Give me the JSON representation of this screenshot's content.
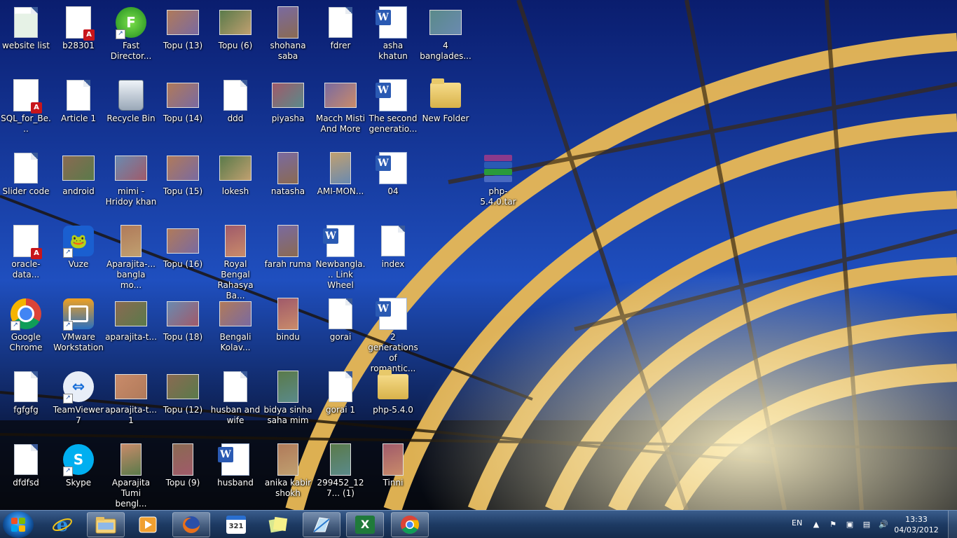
{
  "desktop": {
    "icons": [
      {
        "id": "website-list",
        "label": "website list",
        "kind": "excel-doc"
      },
      {
        "id": "b28301",
        "label": "b28301",
        "kind": "pdf"
      },
      {
        "id": "fast-director",
        "label": "Fast Director...",
        "kind": "app-green"
      },
      {
        "id": "topu-13",
        "label": "Topu (13)",
        "kind": "photo"
      },
      {
        "id": "topu-6",
        "label": "Topu (6)",
        "kind": "photo"
      },
      {
        "id": "shohana-saba",
        "label": "shohana saba",
        "kind": "photo-tall"
      },
      {
        "id": "fdrer",
        "label": "fdrer",
        "kind": "doc"
      },
      {
        "id": "asha-khatun",
        "label": "asha khatun",
        "kind": "word"
      },
      {
        "id": "4-banglades",
        "label": "4 banglades...",
        "kind": "photo"
      },
      {
        "id": "sql-for-be",
        "label": "SQL_for_Be...",
        "kind": "pdf"
      },
      {
        "id": "article-1",
        "label": "Article 1",
        "kind": "doc"
      },
      {
        "id": "recycle-bin",
        "label": "Recycle Bin",
        "kind": "bin"
      },
      {
        "id": "topu-14",
        "label": "Topu (14)",
        "kind": "photo"
      },
      {
        "id": "ddd",
        "label": "ddd",
        "kind": "doc"
      },
      {
        "id": "piyasha",
        "label": "piyasha",
        "kind": "photo"
      },
      {
        "id": "macch-misti",
        "label": "Macch Misti And More",
        "kind": "photo"
      },
      {
        "id": "the-second",
        "label": "The second generatio...",
        "kind": "word"
      },
      {
        "id": "new-folder",
        "label": "New Folder",
        "kind": "folder"
      },
      {
        "id": "slider-code",
        "label": "Slider code",
        "kind": "doc"
      },
      {
        "id": "android",
        "label": "android",
        "kind": "photo"
      },
      {
        "id": "mimi",
        "label": "mimi - Hridoy khan",
        "kind": "photo"
      },
      {
        "id": "topu-15",
        "label": "Topu (15)",
        "kind": "photo"
      },
      {
        "id": "lokesh",
        "label": "lokesh",
        "kind": "photo"
      },
      {
        "id": "natasha",
        "label": "natasha",
        "kind": "photo-tall"
      },
      {
        "id": "ami-mon",
        "label": "AMI-MON...",
        "kind": "photo-tall"
      },
      {
        "id": "04",
        "label": "04",
        "kind": "word"
      },
      {
        "id": "php-tar",
        "label": "php-5.4.0.tar",
        "kind": "rar"
      },
      {
        "id": "oracle-data",
        "label": "oracle-data...",
        "kind": "pdf"
      },
      {
        "id": "vuze",
        "label": "Vuze",
        "kind": "app-vuze"
      },
      {
        "id": "aparajita-bangla",
        "label": "Aparajita-... bangla mo...",
        "kind": "photo-tall"
      },
      {
        "id": "topu-16",
        "label": "Topu (16)",
        "kind": "photo"
      },
      {
        "id": "royal-bengal",
        "label": "Royal Bengal Rahasya Ba...",
        "kind": "photo-tall"
      },
      {
        "id": "farah-ruma",
        "label": "farah ruma",
        "kind": "photo-tall"
      },
      {
        "id": "newbangla",
        "label": "Newbangla... Link Wheel",
        "kind": "word"
      },
      {
        "id": "index",
        "label": "index",
        "kind": "doc"
      },
      {
        "id": "google-chrome",
        "label": "Google Chrome",
        "kind": "app-chrome"
      },
      {
        "id": "vmware",
        "label": "VMware Workstation",
        "kind": "app-vmware"
      },
      {
        "id": "aparajita-t1",
        "label": "aparajita-t...",
        "kind": "photo"
      },
      {
        "id": "topu-18",
        "label": "Topu (18)",
        "kind": "photo"
      },
      {
        "id": "bengali-kolav",
        "label": "Bengali Kolav...",
        "kind": "photo"
      },
      {
        "id": "bindu",
        "label": "bindu",
        "kind": "photo-tall"
      },
      {
        "id": "gorai",
        "label": "gorai",
        "kind": "doc"
      },
      {
        "id": "2-generations",
        "label": "2 generations of romantic...",
        "kind": "word"
      },
      {
        "id": "fgfgfg",
        "label": "fgfgfg",
        "kind": "doc"
      },
      {
        "id": "teamviewer",
        "label": "TeamViewer 7",
        "kind": "app-teamviewer"
      },
      {
        "id": "aparajita-t2",
        "label": "aparajita-t... 1",
        "kind": "photo"
      },
      {
        "id": "topu-12",
        "label": "Topu (12)",
        "kind": "photo"
      },
      {
        "id": "husban-and-wife",
        "label": "husban and wife",
        "kind": "doc"
      },
      {
        "id": "bidya-sinha",
        "label": "bidya sinha saha mim",
        "kind": "photo-tall"
      },
      {
        "id": "gorai-1",
        "label": "gorai 1",
        "kind": "doc"
      },
      {
        "id": "php-540",
        "label": "php-5.4.0",
        "kind": "folder"
      },
      {
        "id": "dfdfsd",
        "label": "dfdfsd",
        "kind": "doc"
      },
      {
        "id": "skype",
        "label": "Skype",
        "kind": "app-skype"
      },
      {
        "id": "aparajita-tumi",
        "label": "Aparajita Tumi bengl...",
        "kind": "photo-tall"
      },
      {
        "id": "topu-9",
        "label": "Topu (9)",
        "kind": "photo-tall"
      },
      {
        "id": "husband",
        "label": "husband",
        "kind": "word"
      },
      {
        "id": "anika-kabir",
        "label": "anika kabir shokh",
        "kind": "photo-tall"
      },
      {
        "id": "299452",
        "label": "299452_127... (1)",
        "kind": "photo-tall"
      },
      {
        "id": "tinni",
        "label": "Tinni",
        "kind": "photo-tall"
      }
    ]
  },
  "taskbar": {
    "pinned": [
      {
        "id": "ie",
        "icon": "internet-explorer-icon"
      },
      {
        "id": "explorer",
        "icon": "windows-explorer-icon"
      },
      {
        "id": "media",
        "icon": "media-player-icon"
      },
      {
        "id": "firefox",
        "icon": "firefox-icon"
      },
      {
        "id": "calendar",
        "icon": "calendar-321-icon",
        "text": "321"
      },
      {
        "id": "sticky",
        "icon": "sticky-notes-icon"
      },
      {
        "id": "snipping",
        "icon": "snipping-tool-icon"
      },
      {
        "id": "excel",
        "icon": "excel-icon",
        "text": "X"
      },
      {
        "id": "chrome",
        "icon": "chrome-icon"
      }
    ],
    "tray": {
      "language": "EN",
      "time": "13:33",
      "date": "04/03/2012"
    }
  },
  "colors": {
    "taskbar_dark": "#142a4a",
    "desktop_blue": "#0f2e86",
    "bridge_gold": "#f2c66a"
  }
}
